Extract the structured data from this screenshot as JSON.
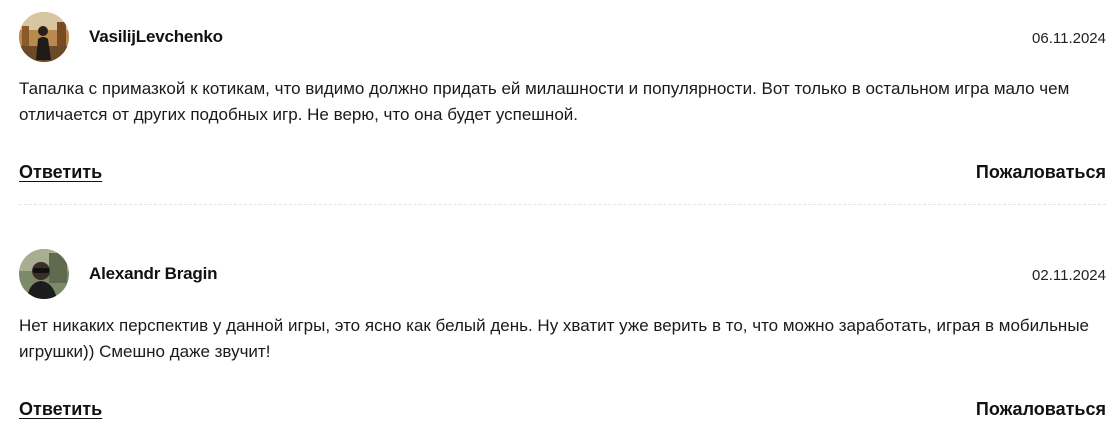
{
  "comments": [
    {
      "author": "VasilijLevchenko",
      "date": "06.11.2024",
      "text": "Тапалка с примазкой к котикам, что видимо должно придать ей милашности и популярности. Вот только в остальном игра мало чем отличается от других подобных игр. Не верю, что она будет успешной.",
      "reply_label": "Ответить",
      "report_label": "Пожаловаться",
      "avatar_icon": "user-photo-avatar"
    },
    {
      "author": "Alexandr Bragin",
      "date": "02.11.2024",
      "text": "Нет никаких перспектив у данной игры, это ясно как белый день. Ну хватит уже верить в то, что можно заработать, играя в мобильные игрушки)) Смешно даже звучит!",
      "reply_label": "Ответить",
      "report_label": "Пожаловаться",
      "avatar_icon": "user-photo-avatar"
    }
  ],
  "colors": {
    "text": "#1a1a1a",
    "divider": "#e3e3e3",
    "background": "#ffffff"
  }
}
